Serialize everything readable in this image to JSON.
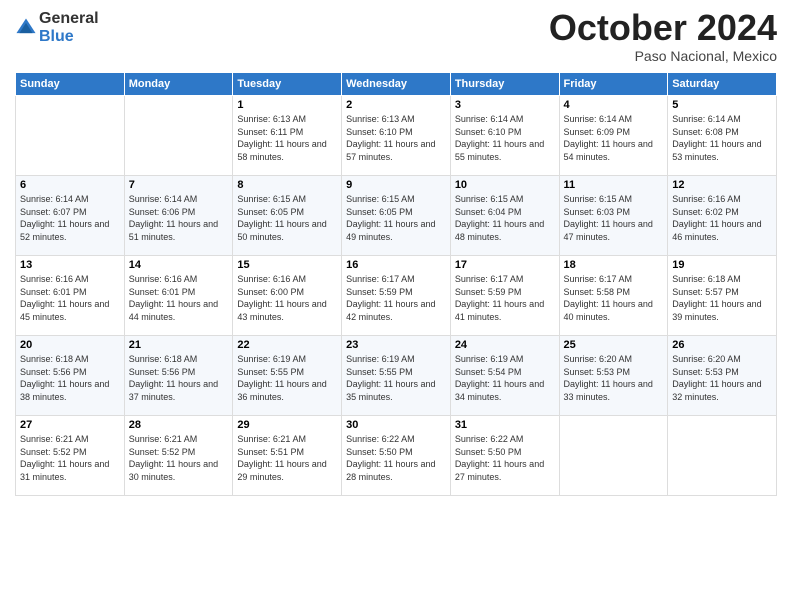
{
  "logo": {
    "general": "General",
    "blue": "Blue"
  },
  "header": {
    "month": "October 2024",
    "location": "Paso Nacional, Mexico"
  },
  "weekdays": [
    "Sunday",
    "Monday",
    "Tuesday",
    "Wednesday",
    "Thursday",
    "Friday",
    "Saturday"
  ],
  "weeks": [
    [
      {
        "day": "",
        "sunrise": "",
        "sunset": "",
        "daylight": ""
      },
      {
        "day": "",
        "sunrise": "",
        "sunset": "",
        "daylight": ""
      },
      {
        "day": "1",
        "sunrise": "Sunrise: 6:13 AM",
        "sunset": "Sunset: 6:11 PM",
        "daylight": "Daylight: 11 hours and 58 minutes."
      },
      {
        "day": "2",
        "sunrise": "Sunrise: 6:13 AM",
        "sunset": "Sunset: 6:10 PM",
        "daylight": "Daylight: 11 hours and 57 minutes."
      },
      {
        "day": "3",
        "sunrise": "Sunrise: 6:14 AM",
        "sunset": "Sunset: 6:10 PM",
        "daylight": "Daylight: 11 hours and 55 minutes."
      },
      {
        "day": "4",
        "sunrise": "Sunrise: 6:14 AM",
        "sunset": "Sunset: 6:09 PM",
        "daylight": "Daylight: 11 hours and 54 minutes."
      },
      {
        "day": "5",
        "sunrise": "Sunrise: 6:14 AM",
        "sunset": "Sunset: 6:08 PM",
        "daylight": "Daylight: 11 hours and 53 minutes."
      }
    ],
    [
      {
        "day": "6",
        "sunrise": "Sunrise: 6:14 AM",
        "sunset": "Sunset: 6:07 PM",
        "daylight": "Daylight: 11 hours and 52 minutes."
      },
      {
        "day": "7",
        "sunrise": "Sunrise: 6:14 AM",
        "sunset": "Sunset: 6:06 PM",
        "daylight": "Daylight: 11 hours and 51 minutes."
      },
      {
        "day": "8",
        "sunrise": "Sunrise: 6:15 AM",
        "sunset": "Sunset: 6:05 PM",
        "daylight": "Daylight: 11 hours and 50 minutes."
      },
      {
        "day": "9",
        "sunrise": "Sunrise: 6:15 AM",
        "sunset": "Sunset: 6:05 PM",
        "daylight": "Daylight: 11 hours and 49 minutes."
      },
      {
        "day": "10",
        "sunrise": "Sunrise: 6:15 AM",
        "sunset": "Sunset: 6:04 PM",
        "daylight": "Daylight: 11 hours and 48 minutes."
      },
      {
        "day": "11",
        "sunrise": "Sunrise: 6:15 AM",
        "sunset": "Sunset: 6:03 PM",
        "daylight": "Daylight: 11 hours and 47 minutes."
      },
      {
        "day": "12",
        "sunrise": "Sunrise: 6:16 AM",
        "sunset": "Sunset: 6:02 PM",
        "daylight": "Daylight: 11 hours and 46 minutes."
      }
    ],
    [
      {
        "day": "13",
        "sunrise": "Sunrise: 6:16 AM",
        "sunset": "Sunset: 6:01 PM",
        "daylight": "Daylight: 11 hours and 45 minutes."
      },
      {
        "day": "14",
        "sunrise": "Sunrise: 6:16 AM",
        "sunset": "Sunset: 6:01 PM",
        "daylight": "Daylight: 11 hours and 44 minutes."
      },
      {
        "day": "15",
        "sunrise": "Sunrise: 6:16 AM",
        "sunset": "Sunset: 6:00 PM",
        "daylight": "Daylight: 11 hours and 43 minutes."
      },
      {
        "day": "16",
        "sunrise": "Sunrise: 6:17 AM",
        "sunset": "Sunset: 5:59 PM",
        "daylight": "Daylight: 11 hours and 42 minutes."
      },
      {
        "day": "17",
        "sunrise": "Sunrise: 6:17 AM",
        "sunset": "Sunset: 5:59 PM",
        "daylight": "Daylight: 11 hours and 41 minutes."
      },
      {
        "day": "18",
        "sunrise": "Sunrise: 6:17 AM",
        "sunset": "Sunset: 5:58 PM",
        "daylight": "Daylight: 11 hours and 40 minutes."
      },
      {
        "day": "19",
        "sunrise": "Sunrise: 6:18 AM",
        "sunset": "Sunset: 5:57 PM",
        "daylight": "Daylight: 11 hours and 39 minutes."
      }
    ],
    [
      {
        "day": "20",
        "sunrise": "Sunrise: 6:18 AM",
        "sunset": "Sunset: 5:56 PM",
        "daylight": "Daylight: 11 hours and 38 minutes."
      },
      {
        "day": "21",
        "sunrise": "Sunrise: 6:18 AM",
        "sunset": "Sunset: 5:56 PM",
        "daylight": "Daylight: 11 hours and 37 minutes."
      },
      {
        "day": "22",
        "sunrise": "Sunrise: 6:19 AM",
        "sunset": "Sunset: 5:55 PM",
        "daylight": "Daylight: 11 hours and 36 minutes."
      },
      {
        "day": "23",
        "sunrise": "Sunrise: 6:19 AM",
        "sunset": "Sunset: 5:55 PM",
        "daylight": "Daylight: 11 hours and 35 minutes."
      },
      {
        "day": "24",
        "sunrise": "Sunrise: 6:19 AM",
        "sunset": "Sunset: 5:54 PM",
        "daylight": "Daylight: 11 hours and 34 minutes."
      },
      {
        "day": "25",
        "sunrise": "Sunrise: 6:20 AM",
        "sunset": "Sunset: 5:53 PM",
        "daylight": "Daylight: 11 hours and 33 minutes."
      },
      {
        "day": "26",
        "sunrise": "Sunrise: 6:20 AM",
        "sunset": "Sunset: 5:53 PM",
        "daylight": "Daylight: 11 hours and 32 minutes."
      }
    ],
    [
      {
        "day": "27",
        "sunrise": "Sunrise: 6:21 AM",
        "sunset": "Sunset: 5:52 PM",
        "daylight": "Daylight: 11 hours and 31 minutes."
      },
      {
        "day": "28",
        "sunrise": "Sunrise: 6:21 AM",
        "sunset": "Sunset: 5:52 PM",
        "daylight": "Daylight: 11 hours and 30 minutes."
      },
      {
        "day": "29",
        "sunrise": "Sunrise: 6:21 AM",
        "sunset": "Sunset: 5:51 PM",
        "daylight": "Daylight: 11 hours and 29 minutes."
      },
      {
        "day": "30",
        "sunrise": "Sunrise: 6:22 AM",
        "sunset": "Sunset: 5:50 PM",
        "daylight": "Daylight: 11 hours and 28 minutes."
      },
      {
        "day": "31",
        "sunrise": "Sunrise: 6:22 AM",
        "sunset": "Sunset: 5:50 PM",
        "daylight": "Daylight: 11 hours and 27 minutes."
      },
      {
        "day": "",
        "sunrise": "",
        "sunset": "",
        "daylight": ""
      },
      {
        "day": "",
        "sunrise": "",
        "sunset": "",
        "daylight": ""
      }
    ]
  ]
}
